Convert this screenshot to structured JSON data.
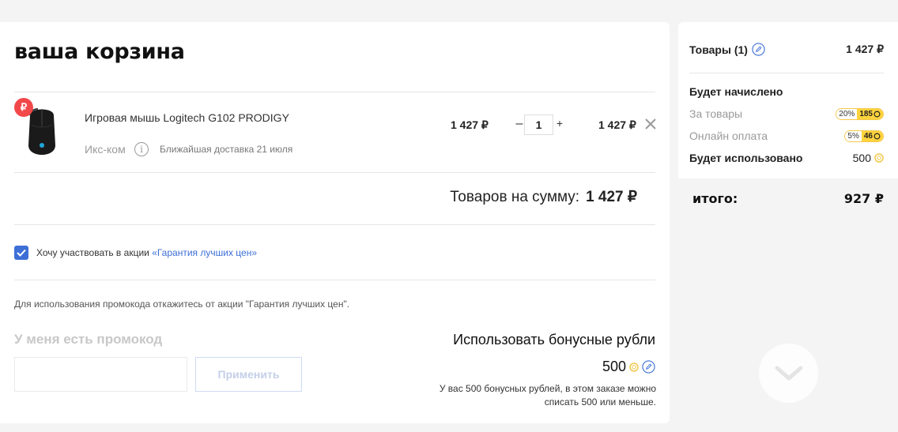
{
  "cart": {
    "title": "ваша корзина",
    "item": {
      "name": "Игровая мышь Logitech G102 PRODIGY",
      "seller": "Икс-ком",
      "info_glyph": "i",
      "delivery": "Ближайшая доставка 21 июля",
      "badge": "₽",
      "unit_price": "1 427 ₽",
      "qty_minus": "–",
      "quantity": "1",
      "qty_plus": "+",
      "line_total": "1 427 ₽"
    },
    "sum_label": "Товаров на сумму:",
    "sum_value": "1 427 ₽",
    "promo_action": {
      "checked": true,
      "label": "Хочу участвовать в акции ",
      "link": "«Гарантия лучших цен»"
    },
    "promo_note": "Для использования промокода откажитесь от акции \"Гарантия лучших цен\".",
    "promo": {
      "title": "У меня есть промокод",
      "input_value": "",
      "apply_label": "Применить"
    },
    "bonus": {
      "title": "Использовать бонусные рубли",
      "amount": "500",
      "note_line1": "У вас 500 бонусных рублей, в этом заказе можно",
      "note_line2": "списать 500 или меньше."
    }
  },
  "summary": {
    "items_label": "Товары (1)",
    "items_value": "1 427 ₽",
    "accrued_heading": "Будет начислено",
    "for_goods_label": "За товары",
    "for_goods_pct": "20%",
    "for_goods_points": "185",
    "online_label": "Онлайн оплата",
    "online_pct": "5%",
    "online_points": "46",
    "used_label": "Будет использовано",
    "used_value": "500",
    "total_label": "итого:",
    "total_value": "927 ₽"
  },
  "colors": {
    "accent_blue": "#3d6fd6",
    "bonus_yellow": "#ffd33d",
    "badge_red": "#f2484a"
  },
  "icons": {
    "pencil": "pencil-icon",
    "coin": "coin-icon",
    "close": "close-icon",
    "info": "info-icon",
    "checkmark": "checkmark-icon",
    "chevron_down": "chevron-down-icon"
  }
}
